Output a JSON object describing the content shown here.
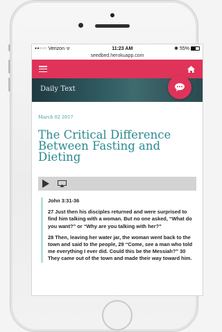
{
  "status_bar": {
    "carrier": "Verizon",
    "time": "11:23 AM",
    "battery": "55%",
    "battery_level": 0.55
  },
  "url": "seedbed.herokuapp.com",
  "header": {
    "accent_color": "#e0335a"
  },
  "banner": {
    "title": "Daily Text"
  },
  "article": {
    "date": "March 02 2017",
    "title": "The Critical Difference Between Fasting and Dieting"
  },
  "scripture": {
    "reference": "John 3:31-36",
    "paragraphs": [
      "27 Just then his disciples returned and were surprised to find him talking with a woman. But no one asked, “What do you want?” or “Why are you talking with her?”",
      "28 Then, leaving her water jar, the woman went back to the town and said to the people, 29 “Come, see a man who told me everything I ever did. Could this be the Messiah?” 30 They came out of the town and made their way toward him."
    ]
  }
}
